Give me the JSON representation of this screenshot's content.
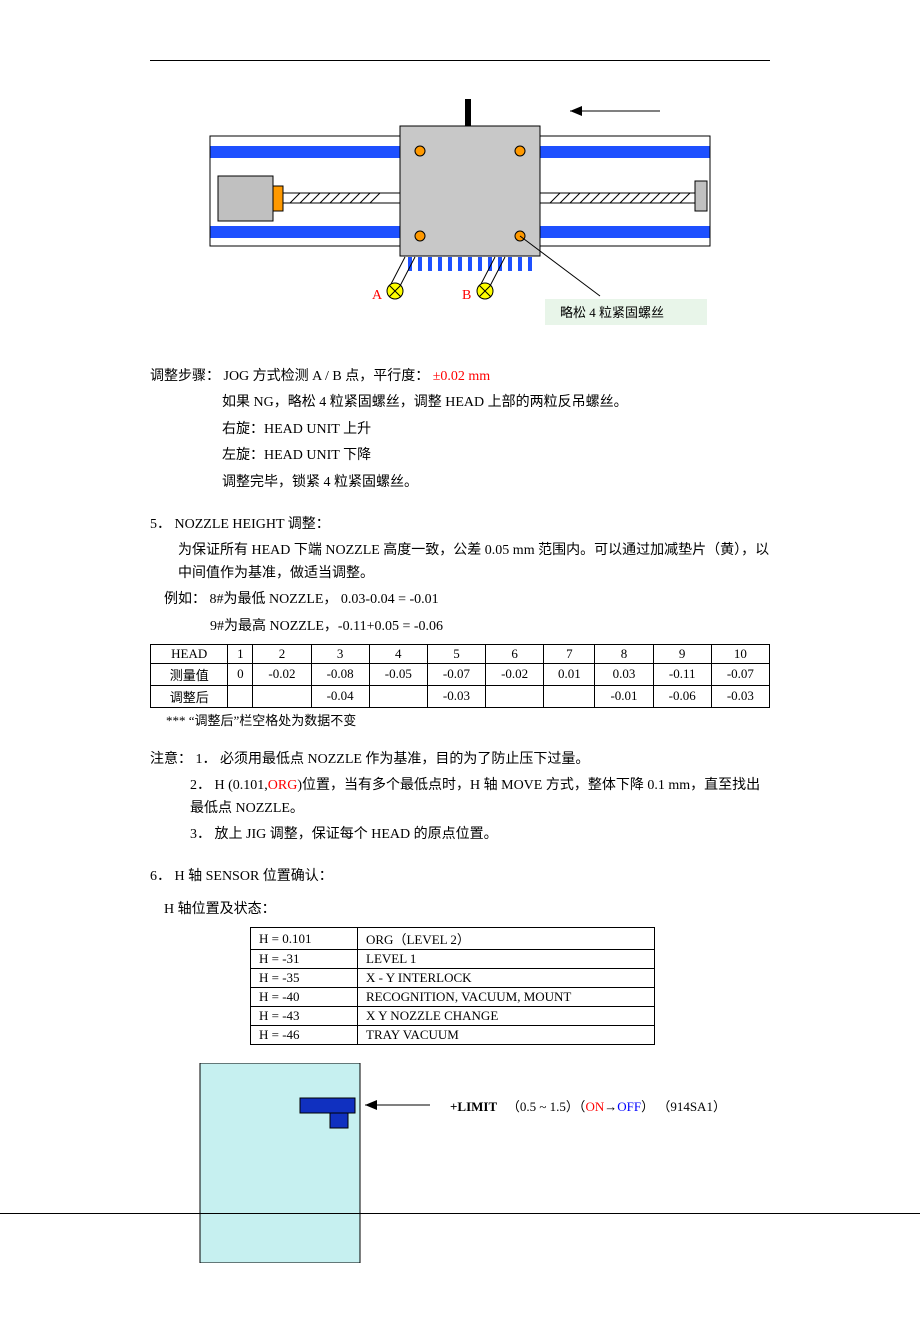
{
  "diagram1": {
    "label_A": "A",
    "label_B": "B",
    "callout": "略松 4 粒紧固螺丝"
  },
  "adjust_steps": {
    "title": "调整步骤：",
    "line1_pre": "JOG 方式检测 A / B 点，平行度：",
    "line1_tol": "±0.02 mm",
    "line2": "如果 NG，略松 4 粒紧固螺丝，调整 HEAD 上部的两粒反吊螺丝。",
    "line3": "右旋：HEAD UNIT  上升",
    "line4": "左旋：HEAD UNIT  下降",
    "line5": "调整完毕，锁紧 4 粒紧固螺丝。"
  },
  "section5": {
    "heading": "5．  NOZZLE HEIGHT 调整：",
    "body1": "为保证所有 HEAD 下端 NOZZLE 高度一致，公差 0.05 mm 范围内。可以通过加减垫片（黄），以中间值作为基准，做适当调整。",
    "ex_label": "例如：",
    "ex1": "8#为最低 NOZZLE，   0.03-0.04 = -0.01",
    "ex2": "9#为最高 NOZZLE，-0.11+0.05 = -0.06"
  },
  "head_table": {
    "headers": [
      "HEAD",
      "1",
      "2",
      "3",
      "4",
      "5",
      "6",
      "7",
      "8",
      "9",
      "10"
    ],
    "row_measure_label": "测量值",
    "row_measure": [
      "0",
      "-0.02",
      "-0.08",
      "-0.05",
      "-0.07",
      "-0.02",
      "0.01",
      "0.03",
      "-0.11",
      "-0.07"
    ],
    "row_adjust_label": "调整后",
    "row_adjust": [
      "",
      "",
      "-0.04",
      "",
      "-0.03",
      "",
      "",
      "-0.01",
      "-0.06",
      "-0.03"
    ],
    "note": "*** “调整后”栏空格处为数据不变"
  },
  "notes": {
    "label": "注意：",
    "n1": "1．  必须用最低点 NOZZLE 作为基准，目的为了防止压下过量。",
    "n2_pre": "2．  H (0.101,",
    "n2_org": "ORG",
    "n2_post": ")位置，当有多个最低点时，H 轴 MOVE 方式，整体下降 0.1 mm，直至找出最低点 NOZZLE。",
    "n3": "3．  放上 JIG 调整，保证每个 HEAD 的原点位置。"
  },
  "section6": {
    "heading": "6．  H 轴 SENSOR 位置确认：",
    "sub": "H 轴位置及状态："
  },
  "h_table": {
    "rows": [
      [
        "H = 0.101",
        "ORG（LEVEL 2）"
      ],
      [
        "H = -31",
        "LEVEL 1"
      ],
      [
        "H = -35",
        "X - Y INTERLOCK"
      ],
      [
        "H = -40",
        "RECOGNITION, VACUUM, MOUNT"
      ],
      [
        "H = -43",
        "X Y NOZZLE CHANGE"
      ],
      [
        "H = -46",
        "TRAY VACUUM"
      ]
    ]
  },
  "limit": {
    "bold": "+LIMIT",
    "range": "（0.5 ~ 1.5）（",
    "on": "ON",
    "arrow": "→",
    "off": "OFF",
    "close": "）  （914SA1）"
  }
}
